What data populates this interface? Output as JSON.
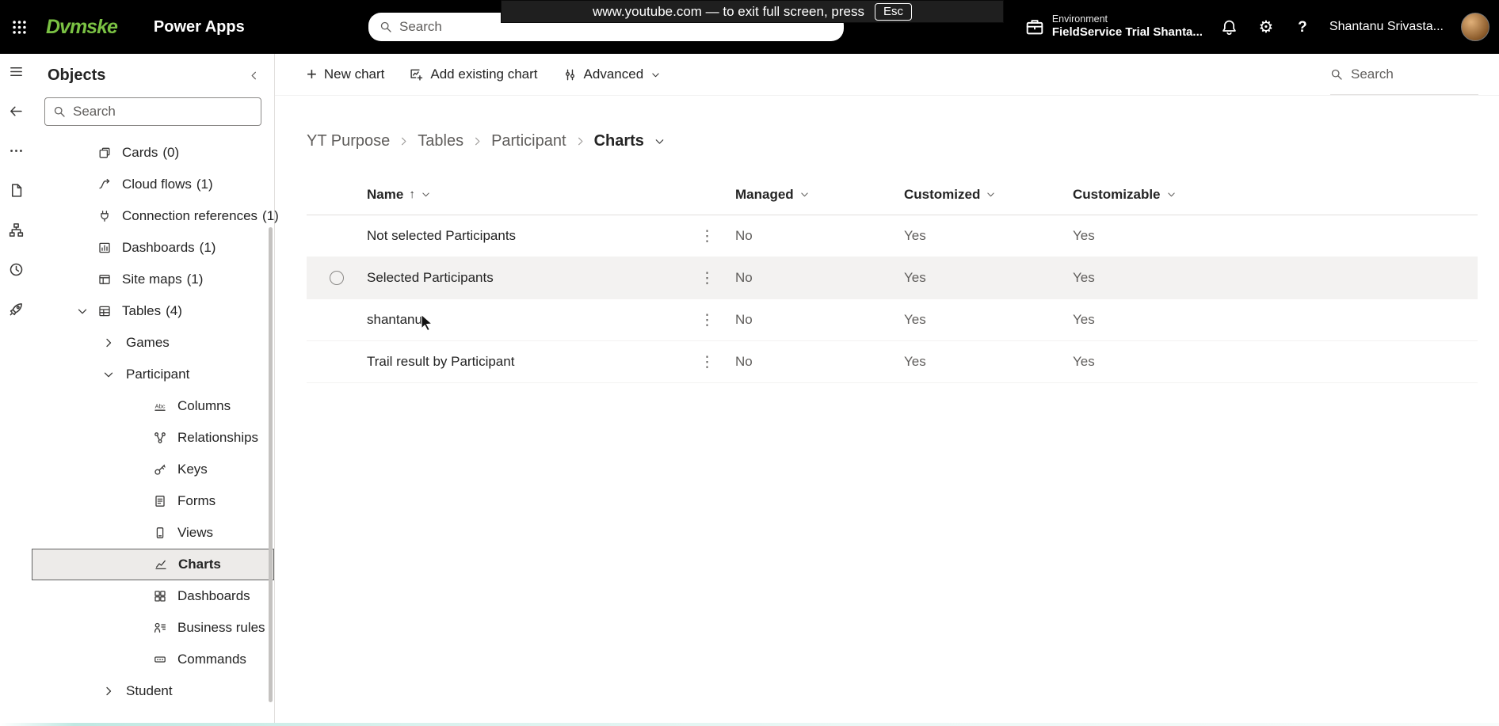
{
  "top_bar": {
    "logo_text": "Dvmske",
    "app_name": "Power Apps",
    "search_placeholder": "Search",
    "fullscreen_toast": {
      "message": "www.youtube.com — to exit full screen, press",
      "key_label": "Esc"
    },
    "environment": {
      "label": "Environment",
      "name": "FieldService Trial Shanta..."
    },
    "user_name": "Shantanu Srivasta..."
  },
  "sidebar": {
    "title": "Objects",
    "search_placeholder": "Search",
    "tree": [
      {
        "label": "Cards",
        "count": "(0)",
        "level": 1,
        "icon": "cards"
      },
      {
        "label": "Cloud flows",
        "count": "(1)",
        "level": 1,
        "icon": "cloud-flows"
      },
      {
        "label": "Connection references",
        "count": "(1)",
        "level": 1,
        "icon": "connection"
      },
      {
        "label": "Dashboards",
        "count": "(1)",
        "level": 1,
        "icon": "dashboard-chart"
      },
      {
        "label": "Site maps",
        "count": "(1)",
        "level": 1,
        "icon": "site-map"
      },
      {
        "label": "Tables",
        "count": "(4)",
        "level": 1,
        "icon": "table",
        "chevron": "down"
      },
      {
        "label": "Games",
        "level": 2,
        "chevron": "right"
      },
      {
        "label": "Participant",
        "level": 2,
        "chevron": "down"
      },
      {
        "label": "Columns",
        "level": 3,
        "icon": "columns"
      },
      {
        "label": "Relationships",
        "level": 3,
        "icon": "relationships"
      },
      {
        "label": "Keys",
        "level": 3,
        "icon": "keys"
      },
      {
        "label": "Forms",
        "level": 3,
        "icon": "forms"
      },
      {
        "label": "Views",
        "level": 3,
        "icon": "views"
      },
      {
        "label": "Charts",
        "level": 3,
        "icon": "charts",
        "selected": true
      },
      {
        "label": "Dashboards",
        "level": 3,
        "icon": "dashboard-grid"
      },
      {
        "label": "Business rules",
        "level": 3,
        "icon": "business-rules"
      },
      {
        "label": "Commands",
        "level": 3,
        "icon": "commands"
      },
      {
        "label": "Student",
        "level": 2,
        "chevron": "right"
      }
    ]
  },
  "command_bar": {
    "new_chart": "New chart",
    "add_existing_chart": "Add existing chart",
    "advanced": "Advanced",
    "search_placeholder": "Search"
  },
  "breadcrumb": {
    "items": [
      "YT Purpose",
      "Tables",
      "Participant",
      "Charts"
    ]
  },
  "table": {
    "columns": [
      {
        "label": "Name",
        "sorted": "ascending"
      },
      {
        "label": "Managed"
      },
      {
        "label": "Customized"
      },
      {
        "label": "Customizable"
      }
    ],
    "rows": [
      {
        "name": "Not selected Participants",
        "managed": "No",
        "customized": "Yes",
        "customizable": "Yes"
      },
      {
        "name": "Selected Participants",
        "managed": "No",
        "customized": "Yes",
        "customizable": "Yes",
        "selected": true
      },
      {
        "name": "shantanu",
        "managed": "No",
        "customized": "Yes",
        "customizable": "Yes"
      },
      {
        "name": "Trail result by Participant",
        "managed": "No",
        "customized": "Yes",
        "customizable": "Yes"
      }
    ]
  }
}
